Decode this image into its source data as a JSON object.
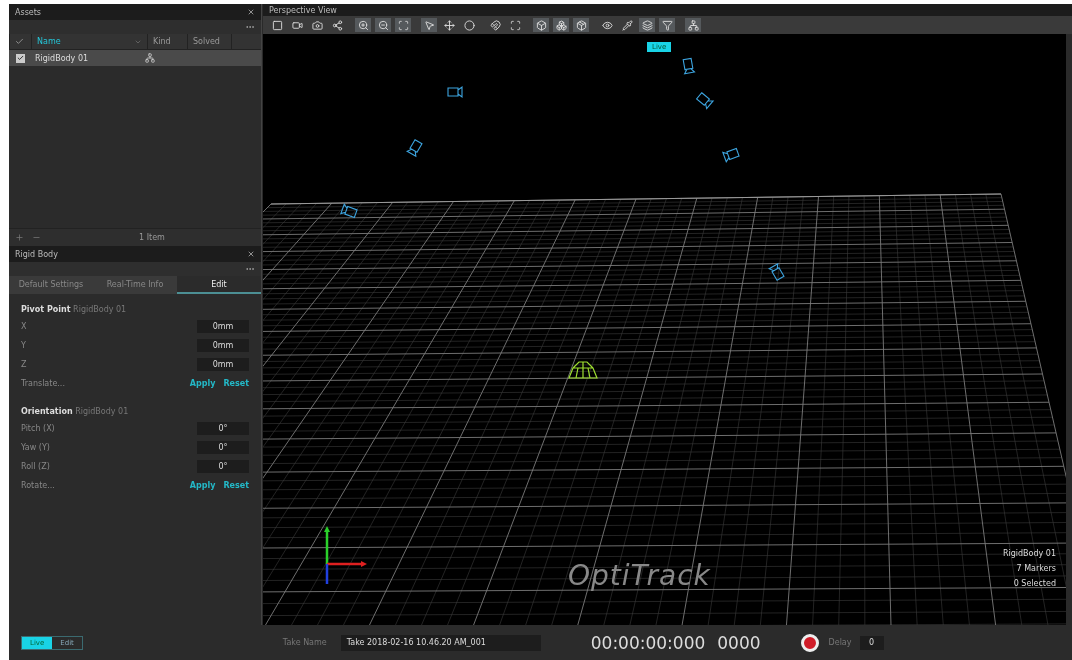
{
  "assets": {
    "title": "Assets",
    "columns": [
      {
        "label": "Name",
        "selected": true
      },
      {
        "label": "Kind",
        "selected": false
      },
      {
        "label": "Solved",
        "selected": false
      }
    ],
    "rows": [
      {
        "name": "RigidBody 01",
        "checked": true,
        "selected": true
      }
    ],
    "footer": "1 Item"
  },
  "rigid_body": {
    "title": "Rigid Body",
    "tabs": [
      {
        "label": "Default Settings",
        "selected": false
      },
      {
        "label": "Real-Time Info",
        "selected": false
      },
      {
        "label": "Edit",
        "selected": true
      }
    ],
    "sections": [
      {
        "title": "Pivot Point",
        "subtitle": "RigidBody 01",
        "fields": [
          {
            "label": "X",
            "value": "0mm"
          },
          {
            "label": "Y",
            "value": "0mm"
          },
          {
            "label": "Z",
            "value": "0mm"
          }
        ],
        "action": "Translate...",
        "buttons": [
          "Apply",
          "Reset"
        ]
      },
      {
        "title": "Orientation",
        "subtitle": "RigidBody 01",
        "fields": [
          {
            "label": "Pitch (X)",
            "value": "0°"
          },
          {
            "label": "Yaw (Y)",
            "value": "0°"
          },
          {
            "label": "Roll (Z)",
            "value": "0°"
          }
        ],
        "action": "Rotate...",
        "buttons": [
          "Apply",
          "Reset"
        ]
      }
    ]
  },
  "viewport": {
    "title": "Perspective View",
    "badge": "Live",
    "logo": "OptiTrack",
    "info": [
      "RigidBody 01",
      "7 Markers",
      "0 Selected"
    ]
  },
  "bottom_bar": {
    "modes": [
      {
        "label": "Live",
        "selected": true
      },
      {
        "label": "Edit",
        "selected": false
      }
    ],
    "take_label": "Take Name",
    "take_value": "Take 2018-02-16 10.46.20 AM_001",
    "timecode": "00:00:00:000",
    "frame": "0000",
    "delay_label": "Delay",
    "delay_value": "0"
  }
}
